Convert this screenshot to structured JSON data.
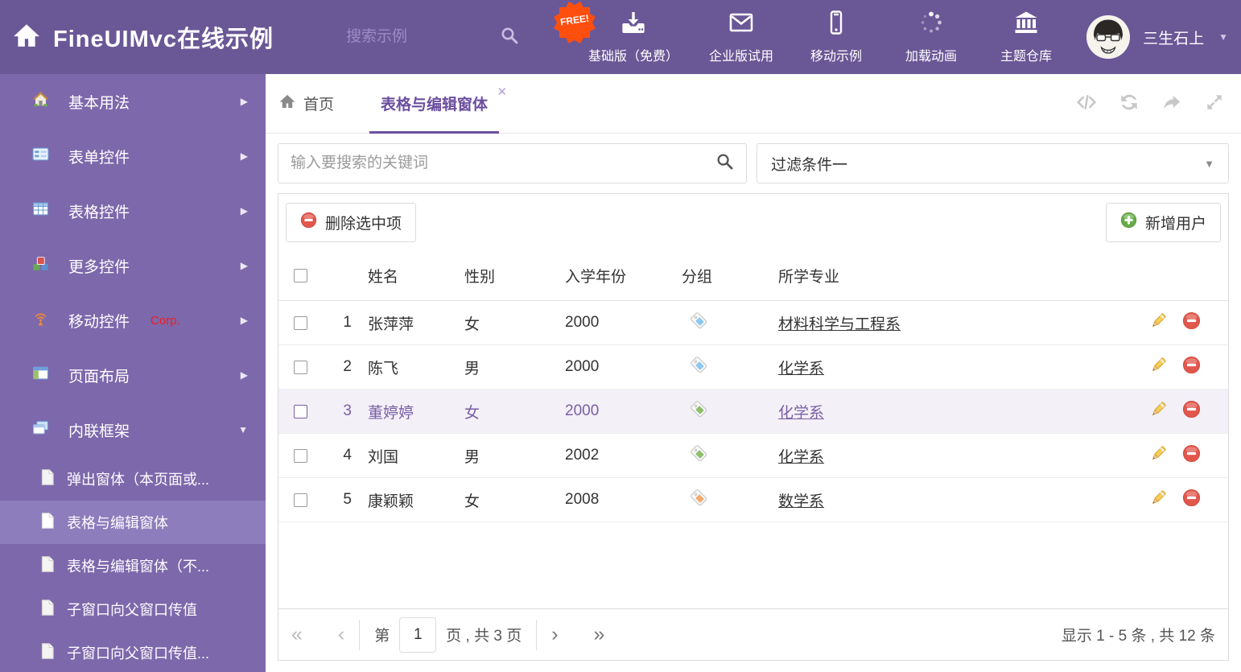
{
  "colors": {
    "header_bg": "#6a5796",
    "sidebar_bg": "#7d68ab",
    "sidebar_active_bg": "#8e7dbc",
    "accent_purple": "#6b4f9e",
    "selected_row_bg": "#f3f0f8",
    "selected_row_text": "#7a5fa5",
    "free_badge_bg": "#ff4f0f",
    "delete_red": "#e2574c",
    "add_green": "#67ab49"
  },
  "icons": {
    "close": "✕",
    "caret_down": "▼",
    "arrow_right": "▶",
    "first": "«",
    "prev": "‹",
    "next": "›",
    "last": "»"
  },
  "header": {
    "title": "FineUIMvc在线示例",
    "search_placeholder": "搜索示例",
    "free_badge": "FREE!",
    "nav": [
      {
        "label": "基础版（免费）",
        "icon": "download-icon"
      },
      {
        "label": "企业版试用",
        "icon": "envelope-icon"
      },
      {
        "label": "移动示例",
        "icon": "phone-icon"
      },
      {
        "label": "加载动画",
        "icon": "spinner-icon"
      },
      {
        "label": "主题仓库",
        "icon": "bank-icon"
      }
    ],
    "username": "三生石上"
  },
  "sidebar": {
    "items": [
      {
        "label": "基本用法",
        "icon": "house-icon"
      },
      {
        "label": "表单控件",
        "icon": "form-icon"
      },
      {
        "label": "表格控件",
        "icon": "table-icon"
      },
      {
        "label": "更多控件",
        "icon": "cubes-icon"
      },
      {
        "label": "移动控件",
        "badge": "Corp.",
        "icon": "antenna-icon"
      },
      {
        "label": "页面布局",
        "icon": "layout-icon"
      },
      {
        "label": "内联框架",
        "icon": "frames-icon",
        "expanded": true
      }
    ],
    "subitems": [
      {
        "label": "弹出窗体（本页面或..."
      },
      {
        "label": "表格与编辑窗体",
        "active": true
      },
      {
        "label": "表格与编辑窗体（不..."
      },
      {
        "label": "子窗口向父窗口传值"
      },
      {
        "label": "子窗口向父窗口传值..."
      }
    ]
  },
  "tabs": {
    "home_label": "首页",
    "active_label": "表格与编辑窗体"
  },
  "filter_bar": {
    "search_placeholder": "输入要搜索的关键词",
    "filter_selected": "过滤条件一"
  },
  "grid": {
    "delete_button": "删除选中项",
    "add_button": "新增用户",
    "columns": {
      "name": "姓名",
      "gender": "性别",
      "year": "入学年份",
      "group": "分组",
      "major": "所学专业"
    },
    "rows": [
      {
        "num": "1",
        "name": "张萍萍",
        "gender": "女",
        "year": "2000",
        "tag_color": "#8cc8f0",
        "major": "材料科学与工程系",
        "selected": false
      },
      {
        "num": "2",
        "name": "陈飞",
        "gender": "男",
        "year": "2000",
        "tag_color": "#8cc8f0",
        "major": "化学系",
        "selected": false
      },
      {
        "num": "3",
        "name": "董婷婷",
        "gender": "女",
        "year": "2000",
        "tag_color": "#8fbe6e",
        "major": "化学系",
        "selected": true
      },
      {
        "num": "4",
        "name": "刘国",
        "gender": "男",
        "year": "2002",
        "tag_color": "#8fbe6e",
        "major": "化学系",
        "selected": false
      },
      {
        "num": "5",
        "name": "康颖颖",
        "gender": "女",
        "year": "2008",
        "tag_color": "#f5a96b",
        "major": "数学系",
        "selected": false
      }
    ]
  },
  "pagination": {
    "prefix": "第",
    "page": "1",
    "suffix": "页 , 共 3 页",
    "summary": "显示 1 - 5 条 , 共 12 条"
  }
}
